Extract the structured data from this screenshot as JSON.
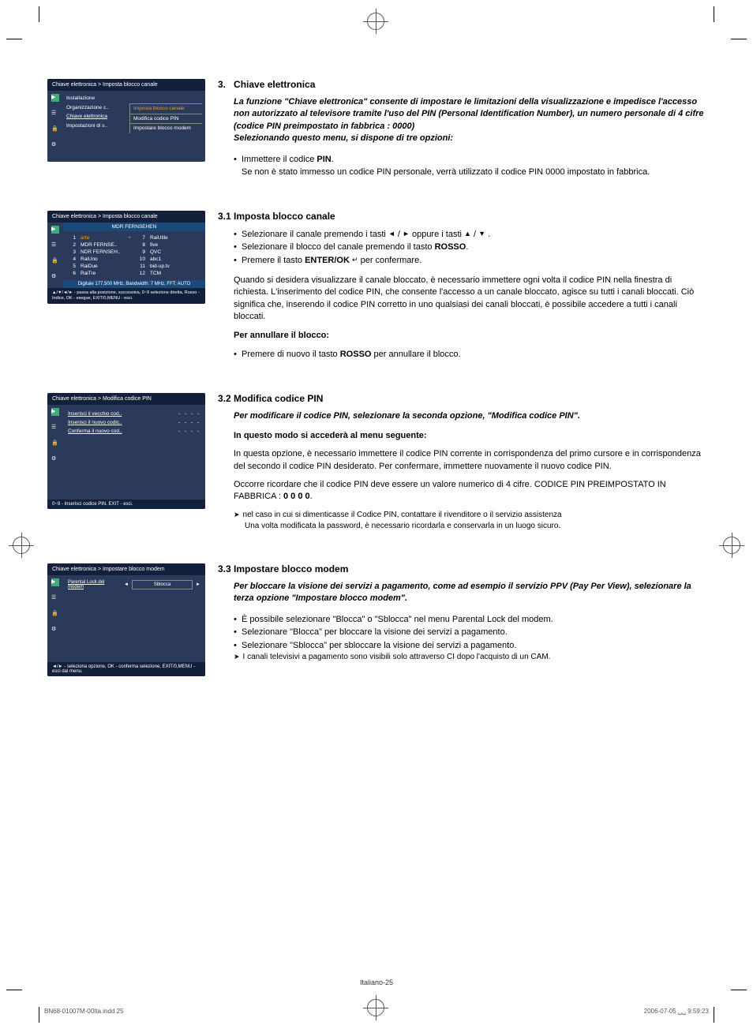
{
  "crop": {
    "present": true
  },
  "osd1": {
    "breadcrumb": "Chiave elettronica > Imposta blocco canale",
    "left_items": [
      "Installazione",
      "Organizzazione c..",
      "Chiave elettronica",
      "Impostazioni di s.."
    ],
    "right_items": [
      "Imposta blocco canale",
      "Modifica codice PIN",
      "Impostare blocco modem"
    ]
  },
  "sec3": {
    "num": "3.",
    "title": "Chiave elettronica",
    "intro": "La funzione \"Chiave elettronica\" consente di impostare le limitazioni della visualizzazione e impedisce l'accesso non autorizzato al televisore tramite l'uso del PIN (Personal Identification Number), un numero personale di 4 cifre (codice PIN preimpostato in fabbrica : 0000)\nSelezionando questo menu, si dispone di tre opzioni:",
    "bullet_prefix": "Immettere il codice ",
    "bullet_bold": "PIN",
    "bullet_suffix": ".",
    "bullet_line2": "Se non è stato immesso un codice PIN personale, verrà utilizzato il codice PIN 0000 impostato in fabbrica."
  },
  "osd2": {
    "breadcrumb": "Chiave elettronica > Imposta blocco canale",
    "header": "MDR FERNSEHEN",
    "left": [
      {
        "n": "1",
        "t": "arte",
        "sel": true,
        "lock": "+"
      },
      {
        "n": "2",
        "t": "MDR FERNSE.."
      },
      {
        "n": "3",
        "t": "NDR FERNSEH.."
      },
      {
        "n": "4",
        "t": "RaiUno"
      },
      {
        "n": "5",
        "t": "RaiDue"
      },
      {
        "n": "6",
        "t": "RaiTre"
      }
    ],
    "right": [
      {
        "n": "7",
        "t": "RaiUtile"
      },
      {
        "n": "8",
        "t": "five"
      },
      {
        "n": "9",
        "t": "QVC"
      },
      {
        "n": "10",
        "t": "abc1"
      },
      {
        "n": "11",
        "t": "bid-up.tv"
      },
      {
        "n": "12",
        "t": "TCM"
      }
    ],
    "footer": "Digitale 177,500 MHz, Bandwidth: 7 MHz, FFT: AUTO",
    "hint": "▲/▼/◄/► - passa alla posizione, successiva, 0~9 selezione diretta, Rosso - Indice, OK - esegue, EXIT/0,MENU - esci."
  },
  "sec31": {
    "title": "3.1 Imposta blocco canale",
    "b1a": "Selezionare il canale premendo i tasti ",
    "b1b": " oppure i tasti ",
    "b1c": " .",
    "b2a": "Selezionare il blocco del canale premendo il tasto ",
    "b2b": "ROSSO",
    "b2c": ".",
    "b3a": "Premere il tasto ",
    "b3b": "ENTER/OK",
    "b3c": " per confermare.",
    "p1": "Quando si desidera visualizzare il canale bloccato, è necessario immettere ogni volta il codice PIN nella finestra di richiesta. L'inserimento del codice PIN, che consente l'accesso a un canale bloccato, agisce su tutti i canali bloccati. Ciò significa che, inserendo il codice PIN corretto in uno qualsiasi dei canali bloccati, è possibile accedere a tutti i canali bloccati.",
    "p2bold": "Per annullare il blocco:",
    "p2a": "Premere di nuovo il tasto ",
    "p2b": "ROSSO",
    "p2c": " per annullare il blocco."
  },
  "osd3": {
    "breadcrumb": "Chiave elettronica > Modifica codice PIN",
    "rows": [
      {
        "label": "Inserisci il vecchio cod..",
        "val": "- - - -"
      },
      {
        "label": "Inserisci il nuovo codic..",
        "val": "- - - -"
      },
      {
        "label": "Conferma il nuovo cod..",
        "val": "- - - -"
      }
    ],
    "footer": "0~9 - Inserisci codice PIN. EXIT - esci."
  },
  "sec32": {
    "title": "3.2  Modifica codice PIN",
    "intro": "Per modificare il codice PIN, selezionare la seconda opzione, \"Modifica codice PIN\".",
    "sub": "In questo modo si accederà al menu seguente:",
    "p1": "In questa opzione, è necessario immettere il codice PIN corrente in corrispondenza del primo cursore e in corrispondenza del secondo il codice PIN desiderato. Per confermare, immettere nuovamente il nuovo codice PIN.",
    "p2a": "Occorre ricordare che il codice PIN deve essere un valore numerico di 4 cifre. CODICE PIN PREIMPOSTATO IN FABBRICA : ",
    "p2b": "0 0 0 0",
    "p2c": ".",
    "n1": "nel caso in cui si dimenticasse il Codice PIN, contattare il rivenditore o il servizio assistenza",
    "n2": "Una volta modificata la password, è necessario ricordarla e conservarla in un luogo sicuro."
  },
  "osd4": {
    "breadcrumb": "Chiave elettronica > Impostare blocco modem",
    "label": "Parental Lock del modem",
    "value": "Sblocca",
    "footer": "◄/► - seleziona opzione, OK - conferma selezione, EXIT/0,MENU - esci dal menu."
  },
  "sec33": {
    "title": "3.3 Impostare blocco modem",
    "intro": "Per bloccare la visione dei servizi a pagamento, come ad esempio il servizio PPV (Pay Per View), selezionare la terza opzione \"Impostare blocco modem\".",
    "b1": "È possibile selezionare \"Blocca\" o \"Sblocca\" nel menu Parental Lock del modem.",
    "b2": "Selezionare \"Blocca\" per bloccare la visione dei servizi a pagamento.",
    "b3": "Selezionare \"Sblocca\" per sbloccare la visione dei servizi a pagamento.",
    "n1": "I canali televisivi a pagamento sono visibili solo attraverso CI dopo l'acquisto di un CAM."
  },
  "footer": {
    "pagenum": "Italiano-25",
    "file": "BN68-01007M-00Ita.indd   25",
    "date": "2006-07-05   ␣␣ 9:59:23"
  }
}
